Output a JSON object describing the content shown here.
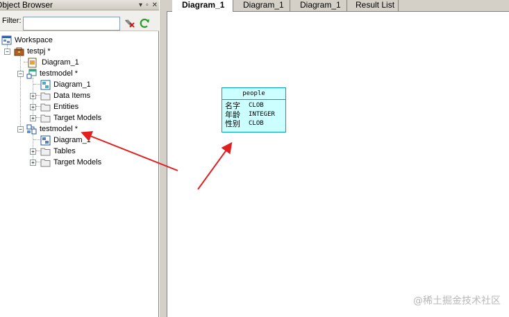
{
  "panel": {
    "title": "Object Browser",
    "controls": [
      "▾",
      "▫",
      "✕"
    ]
  },
  "filter": {
    "label": "Filter:",
    "value": ""
  },
  "tree": {
    "workspace": "Workspace",
    "project": "testpj *",
    "project_diagram": "Diagram_1",
    "model1": "testmodel *",
    "model1_diagram": "Diagram_1",
    "model1_data_items": "Data Items",
    "model1_entities": "Entities",
    "model1_target_models": "Target Models",
    "model2": "testmodel *",
    "model2_diagram": "Diagram_1",
    "model2_tables": "Tables",
    "model2_target_models": "Target Models"
  },
  "tabs": [
    {
      "label": "Diagram_1"
    },
    {
      "label": "Diagram_1"
    },
    {
      "label": "Diagram_1"
    },
    {
      "label": "Result List"
    }
  ],
  "entity": {
    "name": "people",
    "attributes": [
      {
        "name": "名字",
        "type": "CLOB"
      },
      {
        "name": "年龄",
        "type": "INTEGER"
      },
      {
        "name": "性别",
        "type": "CLOB"
      }
    ]
  },
  "watermark": "@稀土掘金技术社区",
  "colors": {
    "entity_fill": "#ccffff",
    "entity_border": "#00a0c0",
    "arrow": "#e02020"
  }
}
